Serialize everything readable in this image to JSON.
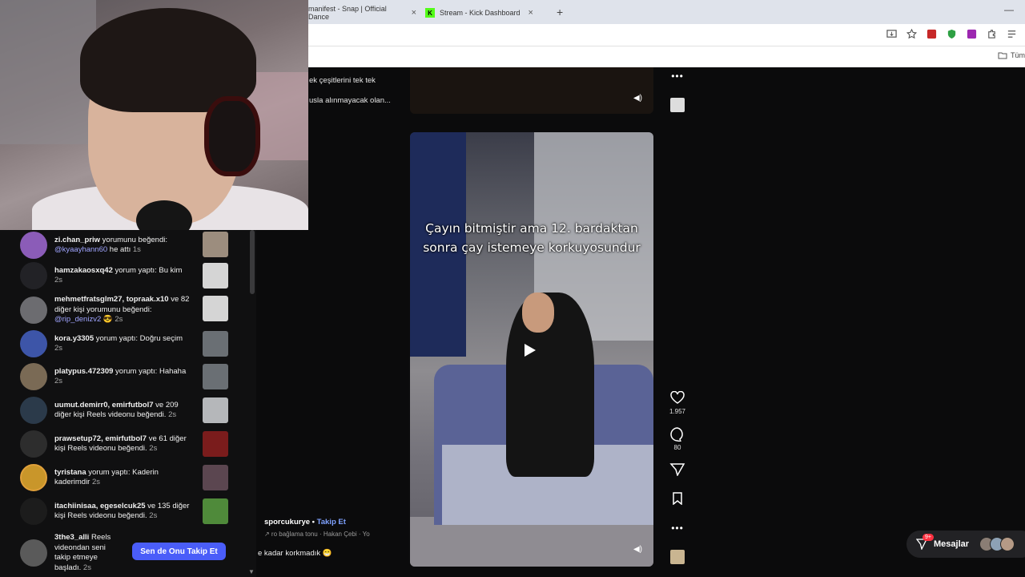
{
  "browser": {
    "tabs": [
      {
        "title": "manifest - Snap | Official Dance",
        "close": "×"
      },
      {
        "title": "Stream - Kick Dashboard",
        "close": "×",
        "icon": "kick-icon"
      }
    ],
    "new_tab": "+",
    "minimize": "—",
    "bookmark_folder": "Tüm"
  },
  "left_partial": {
    "line1": "ek çeşitlerini tek tek",
    "line2": "usla alınmayacak olan..."
  },
  "notifications": [
    {
      "user": "zi.chan_priw",
      "action": " yorumunu beğendi:",
      "mention": "@kyaayhann60",
      "extra": " he attı",
      "ago": "1s",
      "avatar_color": "#8b5cb8",
      "thumb_color": "#9c8d7e"
    },
    {
      "user": "hamzakaosxq42",
      "action": " yorum yaptı: Bu kim",
      "mention": "",
      "extra": "",
      "ago": "2s",
      "avatar_color": "#222226",
      "thumb_color": "#d5d5d5"
    },
    {
      "user": "mehmetfratsglm27, topraak.x10",
      "action": " ve 82 diğer kişi yorumunu beğendi:",
      "mention": "@rip_denizv2",
      "extra": " 😎",
      "ago": "2s",
      "avatar_color": "#6c6c70",
      "thumb_color": "#d5d5d5"
    },
    {
      "user": "kora.y3305",
      "action": " yorum yaptı: Doğru seçim",
      "mention": "",
      "extra": "",
      "ago": "2s",
      "avatar_color": "#3d55a8",
      "thumb_color": "#6a6f74"
    },
    {
      "user": "platypus.472309",
      "action": " yorum yaptı: Hahaha",
      "mention": "",
      "extra": "",
      "ago": "2s",
      "avatar_color": "#7a6a55",
      "thumb_color": "#6a6f74"
    },
    {
      "user": "uumut.demirr0, emirfutbol7",
      "action": " ve 209 diğer kişi Reels videonu beğendi.",
      "mention": "",
      "extra": "",
      "ago": "2s",
      "avatar_color": "#2b3a4a",
      "thumb_color": "#b5b7ba"
    },
    {
      "user": "prawsetup72, emirfutbol7",
      "action": " ve 61 diğer kişi Reels videonu beğendi.",
      "mention": "",
      "extra": "",
      "ago": "2s",
      "avatar_color": "#2d2d2d",
      "thumb_color": "#7a1c1c"
    },
    {
      "user": "tyristana",
      "action": " yorum yaptı: Kaderin kaderimdir",
      "mention": "",
      "extra": "",
      "ago": "2s",
      "avatar_color": "#c9962a",
      "thumb_color": "#5b4650"
    },
    {
      "user": "itachiinisaa, egeselcuk25",
      "action": " ve 135 diğer kişi Reels videonu beğendi.",
      "mention": "",
      "extra": "",
      "ago": "2s",
      "avatar_color": "#1c1c1c",
      "thumb_color": "#4f8a3a"
    },
    {
      "user": "3the3_alli",
      "action": " Reels videondan seni takip etmeye başladı.",
      "mention": "",
      "extra": "",
      "ago": "2s",
      "avatar_color": "#5a5a5a",
      "thumb_color": ""
    }
  ],
  "follow_back_label": "Sen de Onu Takip Et",
  "reel": {
    "caption_line1": "Çayın bitmiştir ama 12. bardaktan",
    "caption_line2": "sonra çay istemeye korkuyosundur",
    "likes": "1.957",
    "comments": "80",
    "author": "sporcukurye",
    "author_sep": " • ",
    "follow": "Takip Et",
    "audio": "↗  ro bağlama tonu · Hakan Çebi · Yo",
    "description": "e kadar korkmadık 😁",
    "more": "•••"
  },
  "messages": {
    "label": "Mesajlar",
    "badge": "9+"
  }
}
